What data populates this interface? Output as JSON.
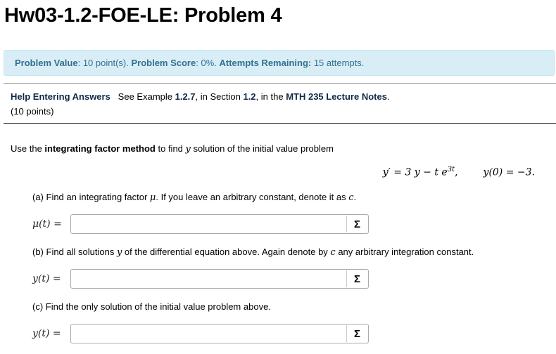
{
  "title": "Hw03-1.2-FOE-LE: Problem 4",
  "info": {
    "value_label": "Problem Value",
    "value_text": ": 10 point(s). ",
    "score_label": "Problem Score",
    "score_text": ": 0%. ",
    "attempts_label": "Attempts Remaining:",
    "attempts_text": " 15 attempts."
  },
  "help": {
    "label": "Help Entering Answers",
    "see": "See Example ",
    "example": "1.2.7",
    "in_section": ", in Section ",
    "section": "1.2",
    "in_the": ", in the ",
    "notes": "MTH 235 Lecture Notes",
    "end": ".",
    "points": "(10 points)"
  },
  "problem": {
    "intro_pre": "Use the ",
    "intro_bold": "integrating factor method",
    "intro_mid": " to find ",
    "intro_var": "y",
    "intro_post": " solution of the initial value problem",
    "eq_lhs": "y′ = 3 y − t e",
    "eq_exp": "3t",
    "eq_comma": ",",
    "eq_ic": "y(0) = −3."
  },
  "parts": [
    {
      "q_pre": "(a) Find an integrating factor ",
      "q_var": "μ",
      "q_mid": ". If you leave an arbitrary constant, denote it as ",
      "q_var2": "c",
      "q_post": ".",
      "label": "μ(t) =",
      "value": "",
      "button": "Σ"
    },
    {
      "q_pre": "(b) Find all solutions ",
      "q_var": "y",
      "q_mid": " of the differential equation above. Again denote by ",
      "q_var2": "c",
      "q_post": " any arbitrary integration constant.",
      "label": "y(t) =",
      "value": "",
      "button": "Σ"
    },
    {
      "q_pre": "(c) Find the only solution of the initial value problem above.",
      "label": "y(t) =",
      "value": "",
      "button": "Σ"
    }
  ]
}
